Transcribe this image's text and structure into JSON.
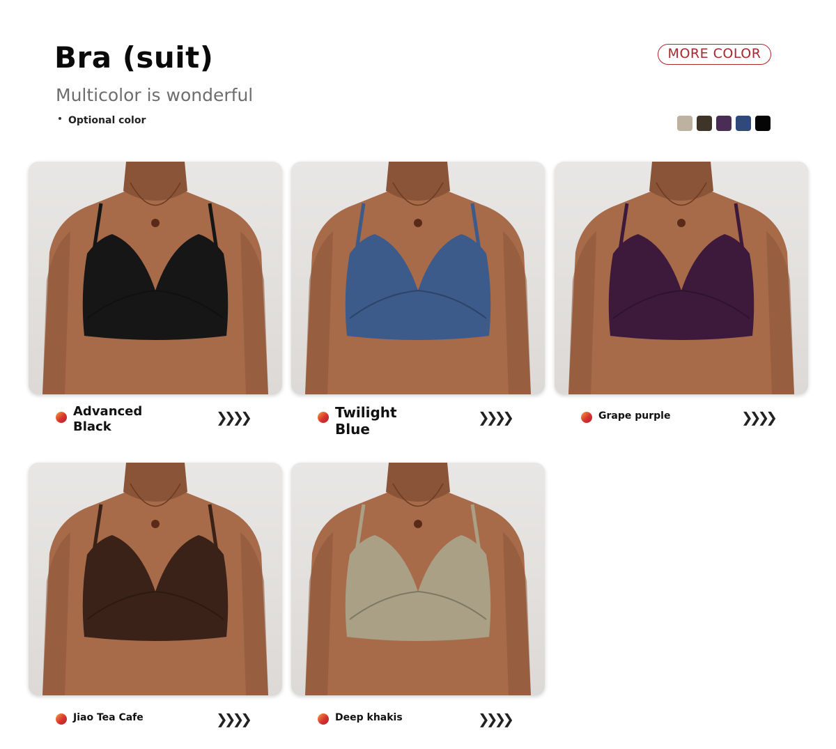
{
  "header": {
    "title": "Bra (suit)",
    "subtitle": "Multicolor is wonderful",
    "optional_label": "Optional color",
    "more_color_label": "MORE COLOR"
  },
  "swatches": [
    {
      "color": "#bdb29f",
      "icon": "swatch"
    },
    {
      "color": "#3f3428",
      "icon": "swatch"
    },
    {
      "color": "#4a2d54",
      "icon": "swatch"
    },
    {
      "color": "#2f4a7a",
      "icon": "swatch"
    },
    {
      "color": "#050505",
      "icon": "swatch"
    }
  ],
  "products": [
    {
      "name": "Advanced Black",
      "arrows": "❯❯❯❯",
      "bra_color": "#161616",
      "icon": "color-bullet-icon"
    },
    {
      "name": "Twilight Blue",
      "arrows": "❯❯❯❯",
      "bra_color": "#3c5a8a",
      "icon": "color-bullet-icon"
    },
    {
      "name": "Grape purple",
      "arrows": "❯❯❯❯",
      "bra_color": "#3d1a3c",
      "icon": "color-bullet-icon"
    },
    {
      "name": "Jiao Tea Cafe",
      "arrows": "❯❯❯❯",
      "bra_color": "#3a2219",
      "icon": "color-bullet-icon"
    },
    {
      "name": "Deep khakis",
      "arrows": "❯❯❯❯",
      "bra_color": "#a9a085",
      "icon": "color-bullet-icon"
    }
  ],
  "palette": {
    "accent": "#b0242c",
    "skin": "#a76b4a",
    "skin_shadow": "#8a5438",
    "background_card": "#e7e5e3"
  }
}
